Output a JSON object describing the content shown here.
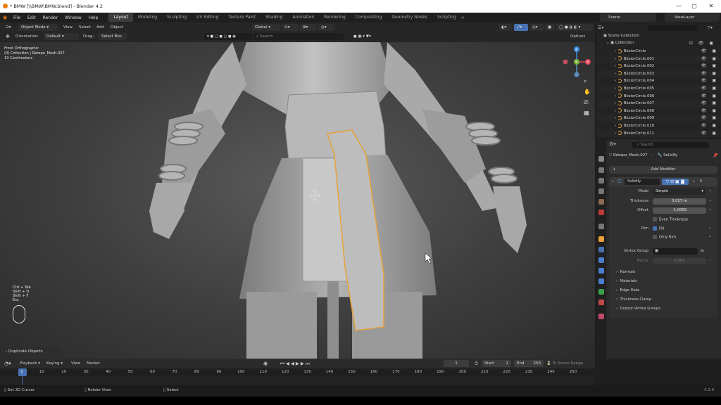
{
  "window": {
    "title": "* BMW [\\\\BMW\\BMW.blend] - Blender 4.2"
  },
  "menu": [
    "File",
    "Edit",
    "Render",
    "Window",
    "Help"
  ],
  "workspaces": [
    "Layout",
    "Modeling",
    "Sculpting",
    "UV Editing",
    "Texture Paint",
    "Shading",
    "Animation",
    "Rendering",
    "Compositing",
    "Geometry Nodes",
    "Scripting"
  ],
  "topright": {
    "scene": "Scene",
    "viewlayer": "ViewLayer"
  },
  "viewport_header": {
    "mode": "Object Mode",
    "view": "View",
    "select": "Select",
    "add": "Add",
    "object": "Object",
    "transform_orientation": "Global",
    "orientation_label": "Orientation:",
    "orientation_value": "Default",
    "drag_label": "Drag:",
    "drag_value": "Select Box",
    "search_placeholder": "Search",
    "options": "Options"
  },
  "viewport": {
    "info_line1": "Front Orthographic",
    "info_line2": "(0) Collection | Retopo_Mesh.027",
    "info_line3": "10 Centimeters",
    "keys": [
      "Ctrl + Tab",
      "Shift + D",
      "Shift + F",
      "Esc"
    ],
    "last_op": "Duplicate Objects",
    "gizmo": {
      "x": "X",
      "y": "Y",
      "z": "Z"
    }
  },
  "outliner": {
    "search_placeholder": "",
    "scene_collection": "Scene Collection",
    "collection": "Collection",
    "items": [
      "BézierCircle",
      "BézierCircle.001",
      "BézierCircle.002",
      "BézierCircle.003",
      "BézierCircle.004",
      "BézierCircle.005",
      "BézierCircle.006",
      "BézierCircle.007",
      "BézierCircle.008",
      "BézierCircle.009",
      "BézierCircle.010",
      "BézierCircle.011"
    ]
  },
  "properties": {
    "search_placeholder": "Search",
    "object_name": "Retopo_Mesh.027",
    "modifier_breadcrumb": "Solidify",
    "add_modifier": "Add Modifier",
    "modifier_name": "Solidify",
    "mode_label": "Mode",
    "mode_value": "Simple",
    "thickness_label": "Thickness",
    "thickness_value": "0.027 m",
    "offset_label": "Offset",
    "offset_value": "-1.0000",
    "even_thickness": "Even Thickness",
    "rim_label": "Rim",
    "rim_fill": "Fill",
    "only_rim": "Only Rim",
    "vertex_group_label": "Vertex Group",
    "factor_label": "Factor",
    "factor_value": "0.000",
    "subpanels": [
      "Normals",
      "Materials",
      "Edge Data",
      "Thickness Clamp",
      "Output Vertex Groups"
    ],
    "rim_fill_checked": true,
    "even_thickness_checked": false,
    "only_rim_checked": false
  },
  "timeline": {
    "playback": "Playback",
    "keying": "Keying",
    "view": "View",
    "marker": "Marker",
    "current_frame": "1",
    "start_label": "Start",
    "start_value": "1",
    "end_label": "End",
    "end_value": "250",
    "scene_range": "To Scene Range",
    "ticks": [
      "1",
      "10",
      "20",
      "30",
      "40",
      "50",
      "60",
      "70",
      "80",
      "90",
      "100",
      "110",
      "120",
      "130",
      "140",
      "150",
      "160",
      "170",
      "180",
      "190",
      "200",
      "210",
      "220",
      "230",
      "240",
      "250"
    ]
  },
  "status": {
    "left": "Set 3D Cursor",
    "middle": "Rotate View",
    "right": "Select",
    "version": "4.2.0"
  },
  "colors": {
    "accent": "#4772b3",
    "selection": "#e8a13a",
    "bg": "#2a2a2a"
  }
}
